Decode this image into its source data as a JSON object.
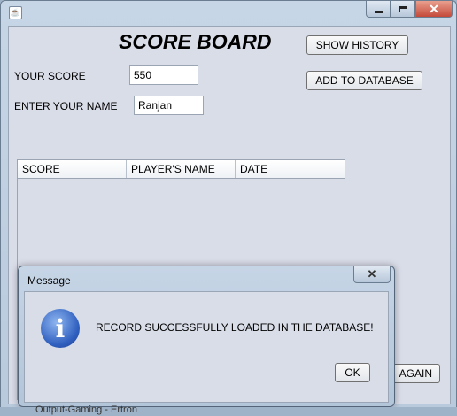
{
  "window": {
    "icon": "java-cup-icon",
    "controls": [
      "minimize-icon",
      "maximize-icon",
      "close-icon"
    ]
  },
  "form": {
    "heading": "SCORE BOARD",
    "your_score_label": "YOUR SCORE",
    "your_score_value": "550",
    "name_label": "ENTER YOUR NAME",
    "name_value": "Ranjan",
    "show_history_label": "SHOW HISTORY",
    "add_to_db_label": "ADD TO DATABASE",
    "play_again_label": "AGAIN"
  },
  "table": {
    "columns": [
      "SCORE",
      "PLAYER'S NAME",
      "DATE"
    ],
    "rows": []
  },
  "dialog": {
    "title": "Message",
    "icon": "info-icon",
    "message": "RECORD SUCCESSFULLY LOADED IN THE DATABASE!",
    "ok_label": "OK"
  },
  "taskbar_fragment": "Output-Gaming - Ertron"
}
